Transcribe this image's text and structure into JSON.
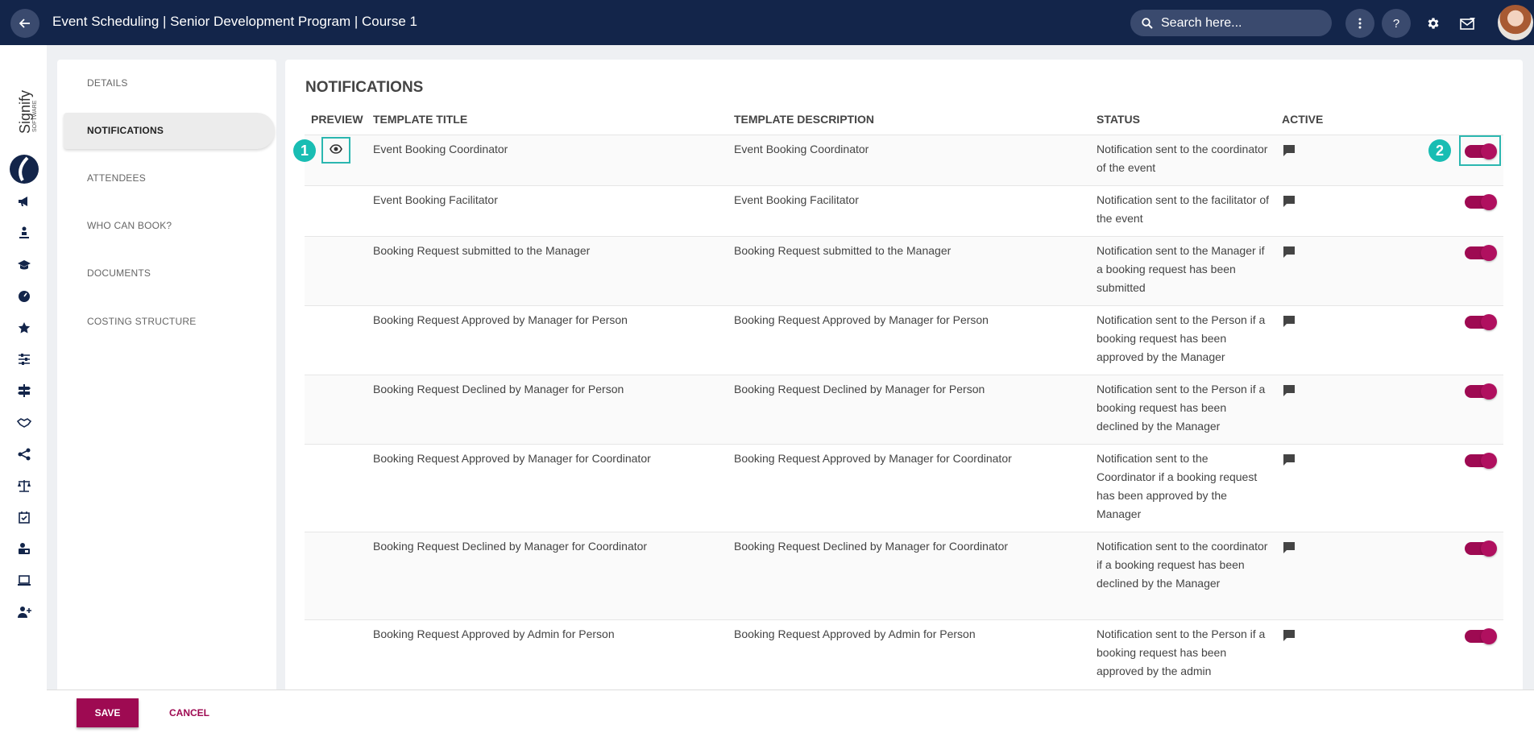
{
  "header": {
    "title": "Event Scheduling | Senior Development Program | Course 1",
    "search_placeholder": "Search here..."
  },
  "logo": {
    "brand": "Signify",
    "sub": "SOFTWARE"
  },
  "subnav": {
    "items": [
      {
        "label": "DETAILS"
      },
      {
        "label": "NOTIFICATIONS"
      },
      {
        "label": "ATTENDEES"
      },
      {
        "label": "WHO CAN BOOK?"
      },
      {
        "label": "DOCUMENTS"
      },
      {
        "label": "COSTING STRUCTURE"
      }
    ],
    "active": "NOTIFICATIONS"
  },
  "notifications": {
    "title": "NOTIFICATIONS",
    "columns": {
      "preview": "PREVIEW",
      "template_title": "TEMPLATE TITLE",
      "template_description": "TEMPLATE DESCRIPTION",
      "status": "STATUS",
      "active": "ACTIVE"
    },
    "rows": [
      {
        "title": "Event Booking Coordinator",
        "description": "Event Booking Coordinator",
        "status": "Notification sent to the coordinator of the event",
        "active": true
      },
      {
        "title": "Event Booking Facilitator",
        "description": "Event Booking Facilitator",
        "status": "Notification sent to the facilitator of the event",
        "active": true
      },
      {
        "title": "Booking Request submitted to the Manager",
        "description": "Booking Request submitted to the Manager",
        "status": "Notification sent to the Manager if a booking request has been submitted",
        "active": true
      },
      {
        "title": "Booking Request Approved by Manager for Person",
        "description": "Booking Request Approved by Manager for Person",
        "status": "Notification sent to the Person if a booking request has been approved by the Manager",
        "active": true
      },
      {
        "title": "Booking Request Declined by Manager for Person",
        "description": "Booking Request Declined by Manager for Person",
        "status": "Notification sent to the Person if a booking request has been declined by the Manager",
        "active": true
      },
      {
        "title": "Booking Request Approved by Manager for Coordinator",
        "description": "Booking Request Approved by Manager for Coordinator",
        "status": "Notification sent to the Coordinator if a booking request has been approved by the Manager",
        "active": true
      },
      {
        "title": "Booking Request Declined by Manager for Coordinator",
        "description": "Booking Request Declined by Manager for Coordinator",
        "status": "Notification sent to the coordinator if a booking request has been declined by the Manager",
        "active": true
      },
      {
        "title": "Booking Request Approved by Admin for Person",
        "description": "Booking Request Approved by Admin for Person",
        "status": "Notification sent to the Person if a booking request has been approved by the admin",
        "active": true
      }
    ]
  },
  "callouts": {
    "one": "1",
    "two": "2"
  },
  "footer": {
    "save_label": "SAVE",
    "cancel_label": "CANCEL"
  },
  "colors": {
    "navy": "#13254a",
    "accent": "#9e0a52",
    "callout": "#19bdb3"
  }
}
